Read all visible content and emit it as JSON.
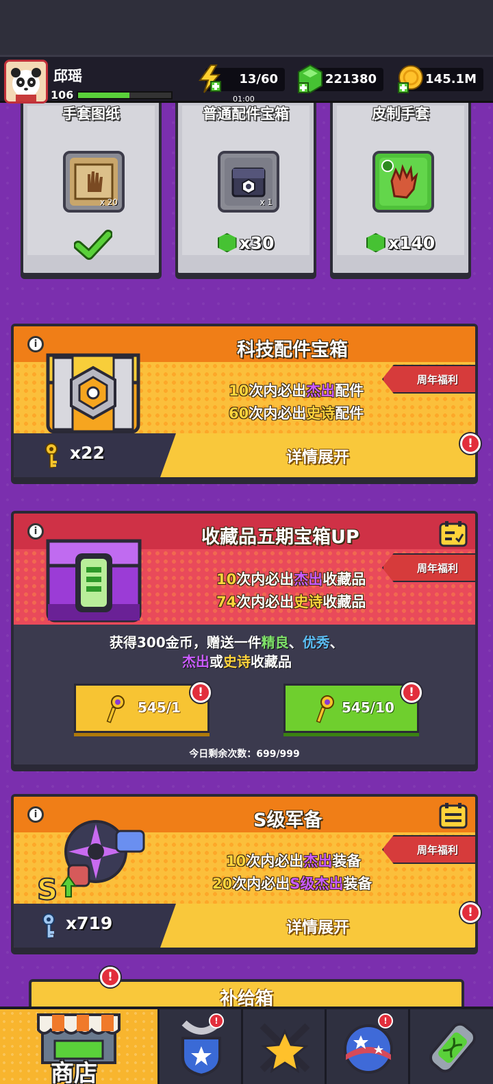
{
  "player": {
    "name": "邱瑶",
    "level": "106",
    "xp_fraction": 0.55
  },
  "resources": {
    "energy": {
      "value": "13/60",
      "timer": "01:00",
      "icon": "lightning-icon"
    },
    "gems": {
      "value": "221380",
      "icon": "gem-icon"
    },
    "coins": {
      "value": "145.1M",
      "icon": "coin-icon"
    }
  },
  "cards": [
    {
      "title": "手套图纸",
      "count": "x 20",
      "status": "claimed",
      "icon": "glove-blueprint-icon"
    },
    {
      "title": "普通配件宝箱",
      "count": "x 1",
      "price": "x30",
      "icon": "chest-icon"
    },
    {
      "title": "皮制手套",
      "price": "x140",
      "icon": "leather-glove-icon"
    }
  ],
  "tech_chest": {
    "title": "科技配件宝箱",
    "ribbon": "周年福利",
    "line1": {
      "n": "10",
      "a": "次内必出",
      "q": "杰出",
      "b": "配件"
    },
    "line2": {
      "n": "60",
      "a": "次内必出",
      "q": "史诗",
      "b": "配件"
    },
    "keys": "x22",
    "detail_label": "详情展开"
  },
  "collect_chest": {
    "title": "收藏品五期宝箱UP",
    "ribbon": "周年福利",
    "line1": {
      "n": "10",
      "a": "次内必出",
      "q": "杰出",
      "b": "收藏品"
    },
    "line2": {
      "n": "74",
      "a": "次内必出",
      "q": "史诗",
      "b": "收藏品"
    },
    "desc1": {
      "a": "获得300金币，赠送一件",
      "q1": "精良",
      "s1": "、",
      "q2": "优秀",
      "s2": "、"
    },
    "desc2": {
      "q3": "杰出",
      "a": "或",
      "q4": "史诗",
      "b": "收藏品"
    },
    "btn1": "545/1",
    "btn2": "545/10",
    "remaining": "今日剩余次数：699/999"
  },
  "s_gear": {
    "title": "S级军备",
    "ribbon": "周年福利",
    "line1": {
      "n": "10",
      "a": "次内必出",
      "q": "杰出",
      "b": "装备"
    },
    "line2": {
      "n": "20",
      "a": "次内必出",
      "q": "S级杰出",
      "b": "装备"
    },
    "keys": "x719",
    "detail_label": "详情展开"
  },
  "supply": {
    "title": "补给箱"
  },
  "nav": {
    "shop": "商店"
  },
  "alert_mark": "!",
  "colors": {
    "orange": "#f7941e",
    "red": "#d63a4a",
    "yellow_button": "#f9c83b",
    "green_button": "#6fcf2e"
  }
}
